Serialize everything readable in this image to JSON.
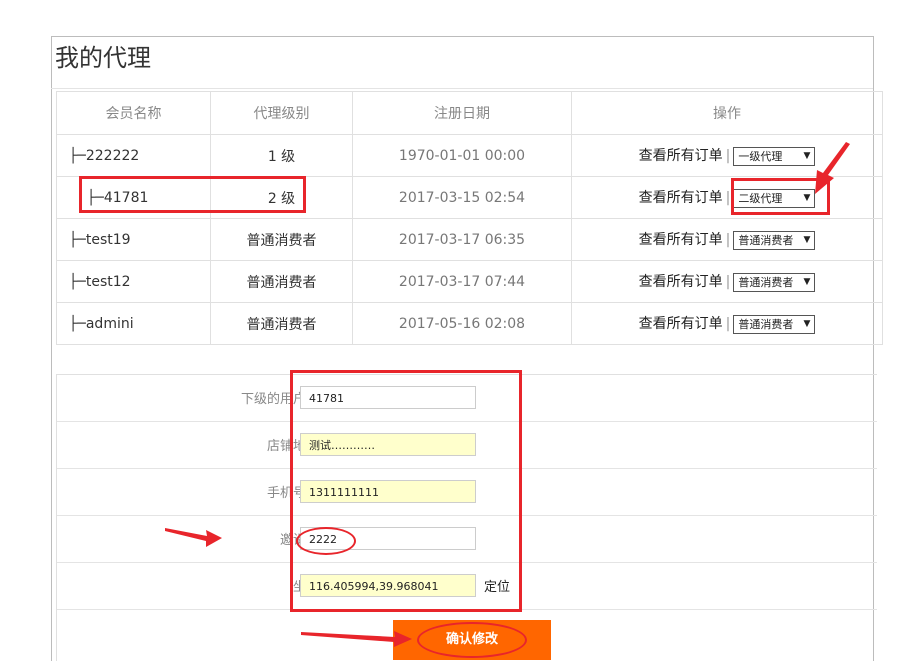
{
  "page_title": "我的代理",
  "table": {
    "headers": [
      "会员名称",
      "代理级别",
      "注册日期",
      "操作"
    ],
    "rows": [
      {
        "name": "├─222222",
        "level": "1 级",
        "date": "1970-01-01 00:00",
        "op_link": "查看所有订单",
        "select": "一级代理"
      },
      {
        "name": "├─41781",
        "level": "2 级",
        "date": "2017-03-15 02:54",
        "op_link": "查看所有订单",
        "select": "二级代理"
      },
      {
        "name": "├─test19",
        "level": "普通消费者",
        "date": "2017-03-17 06:35",
        "op_link": "查看所有订单",
        "select": "普通消费者"
      },
      {
        "name": "├─test12",
        "level": "普通消费者",
        "date": "2017-03-17 07:44",
        "op_link": "查看所有订单",
        "select": "普通消费者"
      },
      {
        "name": "├─admini",
        "level": "普通消费者",
        "date": "2017-05-16 02:08",
        "op_link": "查看所有订单",
        "select": "普通消费者"
      }
    ],
    "separator": "|"
  },
  "form": {
    "username": {
      "label": "下级的用户名：",
      "value": "41781"
    },
    "address": {
      "label": "店铺地址：",
      "value": "测试…………"
    },
    "phone": {
      "label": "手机号码：",
      "value": "1311111111"
    },
    "invite": {
      "label": "邀请码：",
      "value": "2222"
    },
    "coords": {
      "label": "坐标：",
      "value": "116.405994,39.968041",
      "locate": "定位"
    }
  },
  "confirm_label": "确认修改",
  "colors": {
    "accent": "#ff6600",
    "annotation": "#e8252b",
    "field_highlight": "#ffffcc"
  }
}
